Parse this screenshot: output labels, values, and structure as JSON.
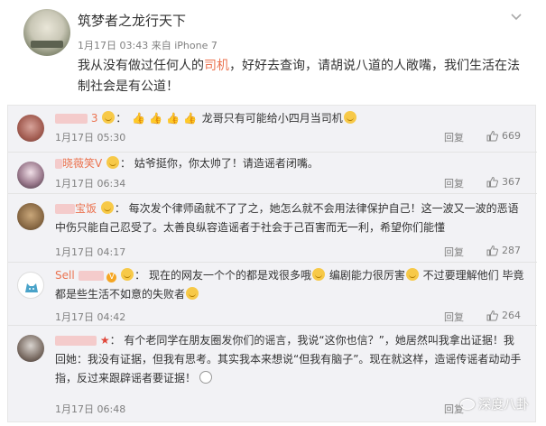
{
  "post": {
    "author": "筑梦者之龙行天下",
    "date": "1月17日 03:43",
    "via": "来自",
    "device": "iPhone 7",
    "text_before": "我从没有做过任何人的",
    "text_highlight": "司机",
    "text_after": "，好好去查询，请胡说八道的人敞嘴，我们生活在法制社会是有公道！"
  },
  "comments": [
    {
      "user_suffix": "3",
      "text": "龙哥只有可能给小四月当司机",
      "time": "1月17日 05:30",
      "reply": "回复",
      "likes": "669"
    },
    {
      "user": "晓薇笑V",
      "text": "姑爷挺你，你太帅了！请造谣者闭嘴。",
      "time": "1月17日 06:34",
      "reply": "回复",
      "likes": "367"
    },
    {
      "user": "宝饭",
      "text": "每次发个律师函就不了了之，她怎么就不会用法律保护自己！这一波又一波的恶语中伤只能自己忍受了。太善良纵容造谣者于社会于己百害而无一利，希望你们能懂",
      "time": "1月17日 04:17",
      "reply": "回复",
      "likes": "287"
    },
    {
      "user": "Sell",
      "text_part1": "现在的网友一个个的都是戏很多哦",
      "text_part2": "编剧能力很厉害",
      "text_part3": "不过要理解他们 毕竟都是些生活不如意的失败者",
      "time": "1月17日 04:42",
      "reply": "回复",
      "likes": "264"
    },
    {
      "text": "有个老同学在朋友圈发你们的谣言，我说“这你也信？”，她居然叫我拿出证据！我回她：我没有证据，但我有思考。其实我本来想说“但我有脑子”。现在就这样，造谣传谣者动动手指，反过来跟辟谣者要证据！",
      "time": "1月17日 06:48",
      "reply": "回复"
    }
  ],
  "watermark": "深度八卦",
  "colors": {
    "accent": "#eb7350",
    "meta": "#808080",
    "panel": "#f2f2f5"
  },
  "icons": [
    "chevron-down-icon",
    "thumbs-up-icon",
    "emoji-icon",
    "like-icon",
    "wechat-icon"
  ]
}
